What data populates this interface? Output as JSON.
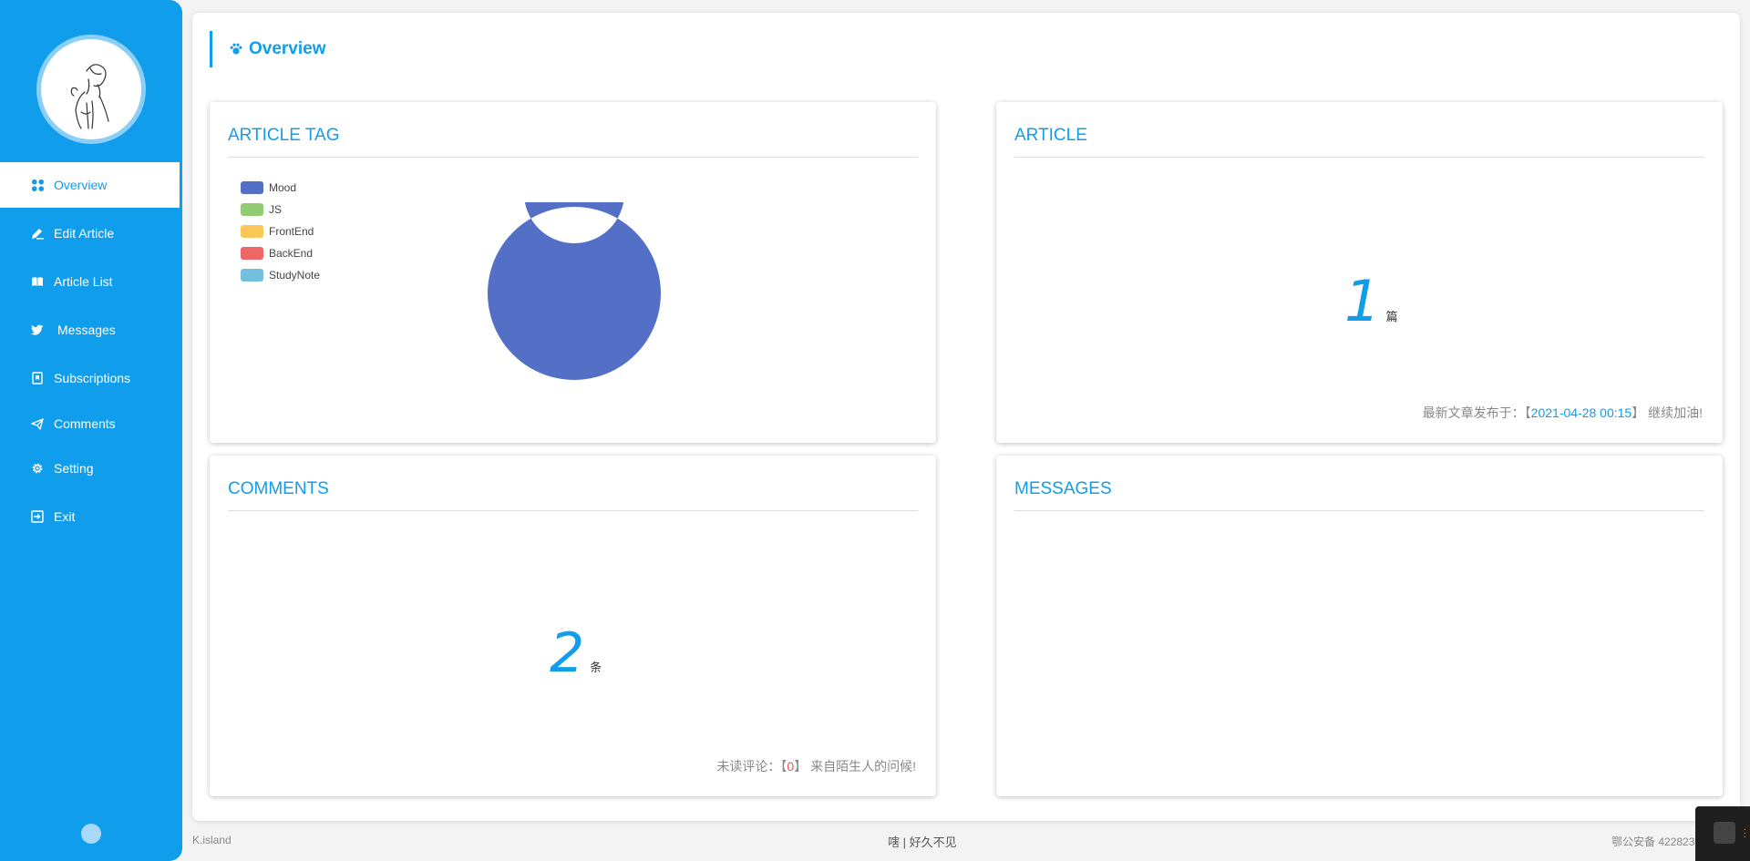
{
  "sidebar": {
    "items": [
      {
        "label": "Overview",
        "icon": "grid-icon",
        "active": true
      },
      {
        "label": "Edit Article",
        "icon": "edit-icon"
      },
      {
        "label": "Article List",
        "icon": "book-icon"
      },
      {
        "label": "Messages",
        "icon": "twitter-icon"
      },
      {
        "label": "Subscriptions",
        "icon": "bookmark-icon"
      },
      {
        "label": "Comments",
        "icon": "send-icon"
      },
      {
        "label": "Setting",
        "icon": "gear-icon"
      },
      {
        "label": "Exit",
        "icon": "exit-icon"
      }
    ]
  },
  "header": {
    "title": "Overview"
  },
  "cards": {
    "article_tag": {
      "title": "ARTICLE TAG",
      "legend": [
        {
          "name": "Mood",
          "color": "#5470c6"
        },
        {
          "name": "JS",
          "color": "#91cc75"
        },
        {
          "name": "FrontEnd",
          "color": "#fac858"
        },
        {
          "name": "BackEnd",
          "color": "#ee6666"
        },
        {
          "name": "StudyNote",
          "color": "#73c0de"
        }
      ]
    },
    "article": {
      "title": "ARTICLE",
      "count": "1",
      "unit": "篇",
      "note_prefix": "最新文章发布于：【",
      "note_date": "2021-04-28 00:15",
      "note_suffix": "】 继续加油!"
    },
    "comments": {
      "title": "COMMENTS",
      "count": "2",
      "unit": "条",
      "note_prefix": "未读评论：【",
      "note_value": "0",
      "note_suffix": "】 来自陌生人的问候!"
    },
    "messages": {
      "title": "MESSAGES"
    }
  },
  "chart_data": {
    "type": "pie",
    "categories": [
      "Mood",
      "JS",
      "FrontEnd",
      "BackEnd",
      "StudyNote"
    ],
    "values": [
      1,
      0,
      0,
      0,
      0
    ],
    "donut": true,
    "legend_position": "top-left"
  },
  "footer": {
    "left": "K.island",
    "center": "嗐 | 好久不见",
    "right": "鄂公安备 422823"
  },
  "colors": {
    "accent": "#109deb",
    "sidebar_bg": "#109deb"
  }
}
